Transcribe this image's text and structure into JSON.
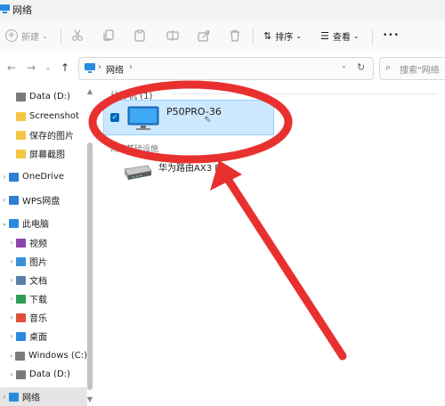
{
  "window": {
    "title": "网络"
  },
  "toolbar": {
    "new_label": "新建",
    "sort_label": "排序",
    "view_label": "查看",
    "more_label": "•••"
  },
  "address": {
    "path": "网络",
    "path_separator": "›",
    "search_placeholder": "搜索\"网络"
  },
  "sidebar": {
    "items": [
      {
        "label": "Data (D:)",
        "icon": "drive-icon",
        "level": 1,
        "chevron": ""
      },
      {
        "label": "Screenshot",
        "icon": "folder-icon",
        "level": 1,
        "chevron": ""
      },
      {
        "label": "保存的图片",
        "icon": "folder-icon",
        "level": 1,
        "chevron": ""
      },
      {
        "label": "屏幕截图",
        "icon": "folder-icon",
        "level": 1,
        "chevron": ""
      },
      {
        "label": "OneDrive",
        "icon": "cloud-icon",
        "level": 0,
        "chevron": "›"
      },
      {
        "label": "WPS网盘",
        "icon": "cloud-icon",
        "level": 0,
        "chevron": "›"
      },
      {
        "label": "此电脑",
        "icon": "pc-icon",
        "level": 0,
        "chevron": "⌄"
      },
      {
        "label": "视频",
        "icon": "video-icon",
        "level": 1,
        "chevron": "›"
      },
      {
        "label": "图片",
        "icon": "picture-icon",
        "level": 1,
        "chevron": "›"
      },
      {
        "label": "文档",
        "icon": "document-icon",
        "level": 1,
        "chevron": "›"
      },
      {
        "label": "下载",
        "icon": "download-icon",
        "level": 1,
        "chevron": "›"
      },
      {
        "label": "音乐",
        "icon": "music-icon",
        "level": 1,
        "chevron": "›"
      },
      {
        "label": "桌面",
        "icon": "desktop-icon",
        "level": 1,
        "chevron": "›"
      },
      {
        "label": "Windows (C:)",
        "icon": "drive-icon",
        "level": 1,
        "chevron": "›"
      },
      {
        "label": "Data (D:)",
        "icon": "drive-icon",
        "level": 1,
        "chevron": "›"
      },
      {
        "label": "网络",
        "icon": "network-icon",
        "level": 0,
        "chevron": "›",
        "selected": true
      }
    ]
  },
  "main": {
    "group_computers": "计算机 (1)",
    "group_media": "网络基础设施",
    "computer_name": "P50PRO-36",
    "router_name": "华为路由AX3 Pro"
  },
  "colors": {
    "accent": "#0067c0",
    "selection_bg": "#cce8ff",
    "annotation_red": "#e8312f"
  }
}
